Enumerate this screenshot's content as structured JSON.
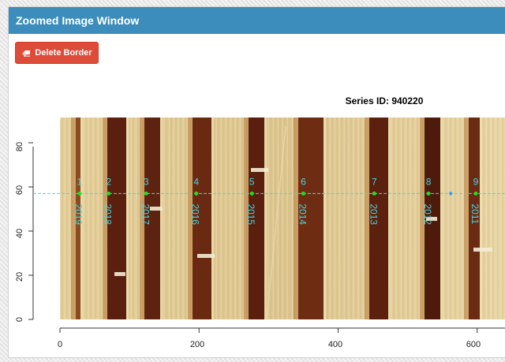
{
  "window": {
    "title": "Zoomed Image Window"
  },
  "toolbar": {
    "delete_border_label": "Delete Border",
    "delete_icon": "eraser-icon"
  },
  "plot": {
    "title": "Series ID: 940220",
    "x_ticks": [
      "0",
      "200",
      "400",
      "600"
    ],
    "y_ticks": [
      "0",
      "20",
      "40",
      "60",
      "80"
    ],
    "x_range": [
      0,
      640
    ],
    "y_range": [
      0,
      90
    ],
    "path_y": 57,
    "line_color": "#44d7e6",
    "point_color": "#22dd22",
    "points": [
      {
        "n": "1",
        "year": "2019",
        "x": 28
      },
      {
        "n": "2",
        "year": "2018",
        "x": 70
      },
      {
        "n": "3",
        "year": "2017",
        "x": 124
      },
      {
        "n": "4",
        "year": "2016",
        "x": 196
      },
      {
        "n": "5",
        "year": "2015",
        "x": 276
      },
      {
        "n": "6",
        "year": "2014",
        "x": 350
      },
      {
        "n": "7",
        "year": "2013",
        "x": 452
      },
      {
        "n": "8",
        "year": "2012",
        "x": 530
      },
      {
        "n": "9",
        "year": "2011",
        "x": 598
      }
    ],
    "extra_marker_x": 562
  }
}
